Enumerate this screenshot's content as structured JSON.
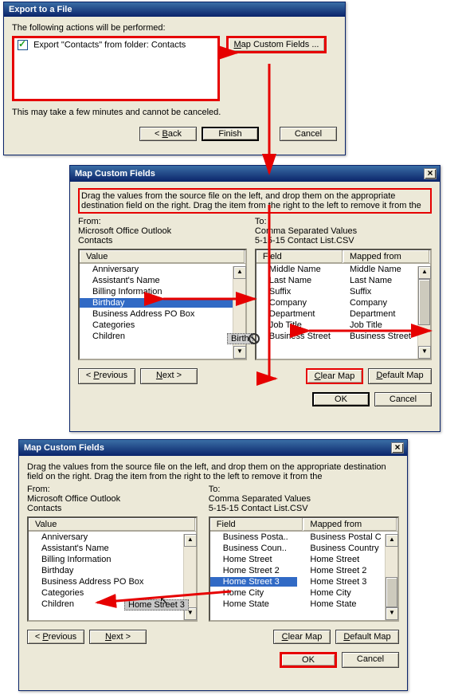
{
  "export_dialog": {
    "title": "Export to a File",
    "intro": "The following actions will be performed:",
    "action_item": "Export \"Contacts\" from folder: Contacts",
    "footnote": "This may take a few minutes and cannot be canceled.",
    "btn_map": "Map Custom Fields ...",
    "btn_back": "< Back",
    "btn_finish": "Finish",
    "btn_cancel": "Cancel"
  },
  "map1": {
    "title": "Map Custom Fields",
    "instr": "Drag the values from the source file on the left, and drop them on the appropriate destination field on the right.  Drag the item from the right to the left to remove it from the",
    "from_label": "From:",
    "from_src": "Microsoft Office Outlook",
    "from_sub": "Contacts",
    "to_label": "To:",
    "to_src": "Comma Separated Values",
    "to_sub": "5-15-15 Contact List.CSV",
    "col_value": "Value",
    "col_field": "Field",
    "col_mapped": "Mapped from",
    "from_rows": [
      "Anniversary",
      "Assistant's Name",
      "Billing Information",
      "Birthday",
      "Business Address PO Box",
      "Categories",
      "Children"
    ],
    "to_rows": [
      {
        "f": "Middle Name",
        "m": "Middle Name"
      },
      {
        "f": "Last Name",
        "m": "Last Name"
      },
      {
        "f": "Suffix",
        "m": "Suffix"
      },
      {
        "f": "Company",
        "m": "Company"
      },
      {
        "f": "Department",
        "m": "Department"
      },
      {
        "f": "Job Title",
        "m": "Job Title"
      },
      {
        "f": "Business Street",
        "m": "Business Street"
      }
    ],
    "drag_label": "Birth",
    "btn_prev": "< Previous",
    "btn_next": "Next >",
    "btn_clear": "Clear Map",
    "btn_default": "Default Map",
    "btn_ok": "OK",
    "btn_cancel": "Cancel"
  },
  "map2": {
    "title": "Map Custom Fields",
    "instr": "Drag the values from the source file on the left, and drop them on the appropriate destination field on the right.  Drag the item from the right to the left to remove it from the",
    "from_label": "From:",
    "from_src": "Microsoft Office Outlook",
    "from_sub": "Contacts",
    "to_label": "To:",
    "to_src": "Comma Separated Values",
    "to_sub": "5-15-15 Contact List.CSV",
    "col_value": "Value",
    "col_field": "Field",
    "col_mapped": "Mapped from",
    "from_rows": [
      "Anniversary",
      "Assistant's Name",
      "Billing Information",
      "Birthday",
      "Business Address PO Box",
      "Categories",
      "Children"
    ],
    "to_rows": [
      {
        "f": "Business Posta..",
        "m": "Business Postal C"
      },
      {
        "f": "Business Coun..",
        "m": "Business Country"
      },
      {
        "f": "Home Street",
        "m": "Home Street"
      },
      {
        "f": "Home Street 2",
        "m": "Home Street 2"
      },
      {
        "f": "Home Street 3",
        "m": "Home Street 3"
      },
      {
        "f": "Home City",
        "m": "Home City"
      },
      {
        "f": "Home State",
        "m": "Home State"
      }
    ],
    "drag_label": "Home Street 3",
    "btn_prev": "< Previous",
    "btn_next": "Next >",
    "btn_clear": "Clear Map",
    "btn_default": "Default Map",
    "btn_ok": "OK",
    "btn_cancel": "Cancel"
  }
}
